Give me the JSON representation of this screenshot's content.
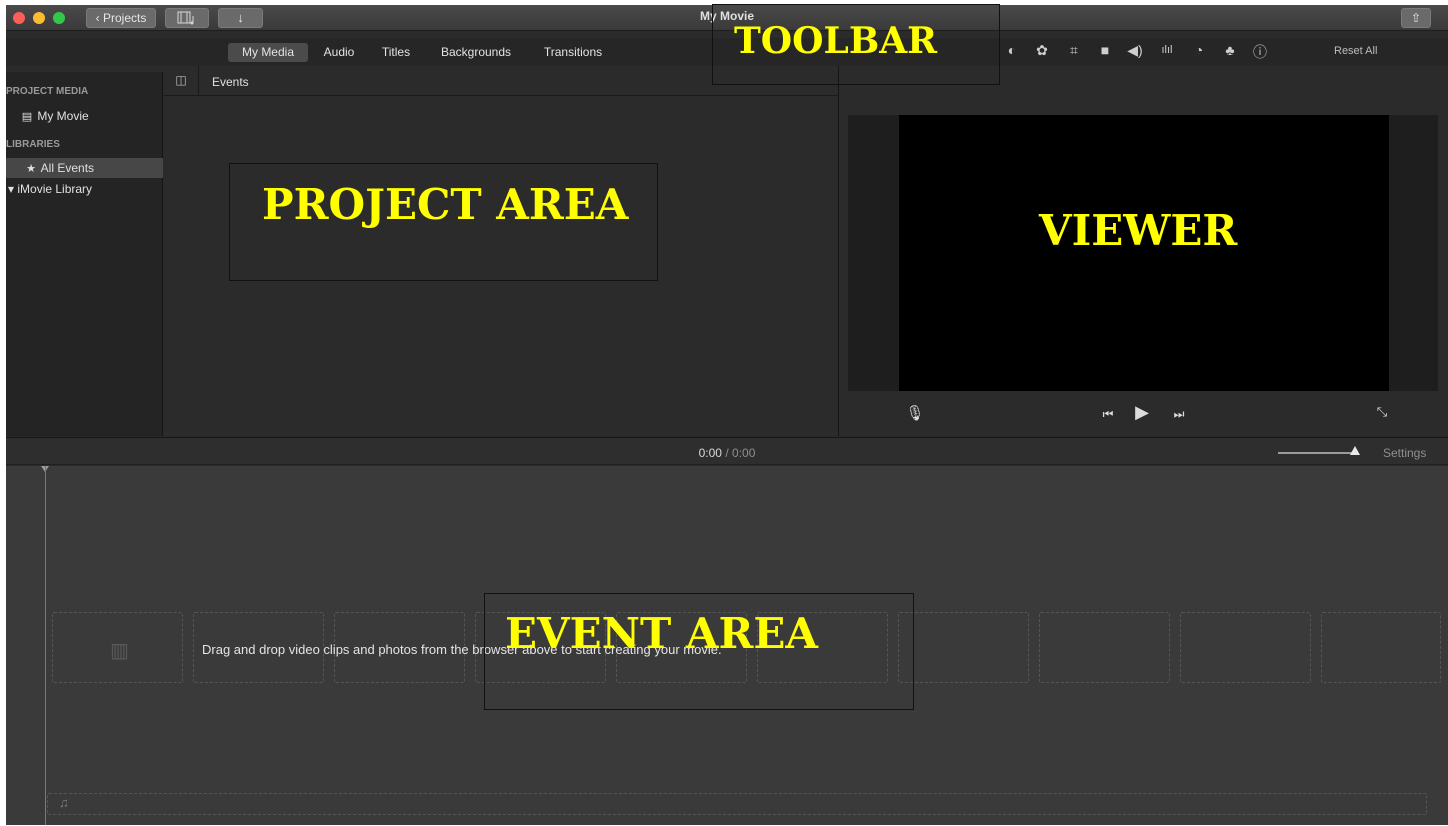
{
  "window": {
    "title": "My Movie",
    "projects_button": "Projects",
    "projects_chevron": "‹",
    "media_button_icon": "film-music-icon",
    "import_icon": "↓",
    "share_icon": "⇧"
  },
  "toolbar": {
    "tabs": [
      "My Media",
      "Audio",
      "Titles",
      "Backgrounds",
      "Transitions"
    ],
    "active_tab": "My Media",
    "adjustment_icons": [
      "color-balance-icon",
      "color-palette-icon",
      "crop-icon",
      "stabilization-icon",
      "volume-icon",
      "equalizer-icon",
      "speed-icon",
      "filter-icon",
      "info-icon"
    ],
    "reset_all": "Reset All"
  },
  "sidebar": {
    "project_media_heading": "PROJECT MEDIA",
    "project_item": "My Movie",
    "libraries_heading": "LIBRARIES",
    "all_events": "All Events",
    "library": "▾ iMovie Library"
  },
  "browser": {
    "events_label": "Events"
  },
  "viewer": {
    "controls": [
      "microphone-icon",
      "skip-back-icon",
      "play-icon",
      "skip-forward-icon",
      "fullscreen-icon"
    ]
  },
  "timeline": {
    "current_time": "0:00",
    "separator": "/",
    "total_time": "0:00",
    "settings_label": "Settings",
    "drop_hint": "Drag and drop video clips and photos from the browser above to start creating your movie."
  },
  "annotations": {
    "toolbar": "TOOLBAR",
    "project_area": "PROJECT AREA",
    "viewer": "VIEWER",
    "event_area": "EVENT AREA",
    "color": "#ffff00"
  }
}
